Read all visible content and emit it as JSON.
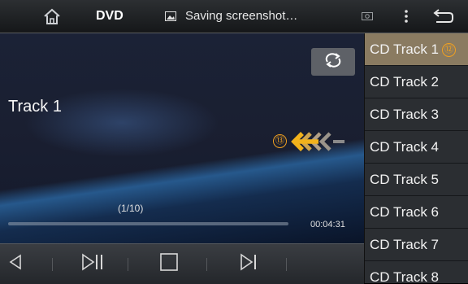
{
  "topbar": {
    "title": "DVD",
    "status_text": "Saving screenshot…",
    "icons": [
      "home-icon",
      "screenshot-icon",
      "camera-icon",
      "menu-icon",
      "back-icon"
    ]
  },
  "player": {
    "track_title": "Track 1",
    "track_counter": "(1/10)",
    "elapsed_time": "00:04:31",
    "progress": 0.0,
    "repeat_icon": "repeat-icon",
    "callout": "⑬"
  },
  "controls": [
    "previous-icon",
    "play-pause-icon",
    "stop-icon",
    "next-icon"
  ],
  "playlist": {
    "callout": "⑫",
    "items": [
      {
        "label": "CD Track 1",
        "active": true
      },
      {
        "label": "CD Track 2",
        "active": false
      },
      {
        "label": "CD Track 3",
        "active": false
      },
      {
        "label": "CD Track 4",
        "active": false
      },
      {
        "label": "CD Track 5",
        "active": false
      },
      {
        "label": "CD Track 6",
        "active": false
      },
      {
        "label": "CD Track 7",
        "active": false
      },
      {
        "label": "CD Track 8",
        "active": false
      }
    ]
  },
  "colors": {
    "active_item": "#8a7b61",
    "callout": "#f0a020",
    "arrow_main": "#f2b21b"
  }
}
